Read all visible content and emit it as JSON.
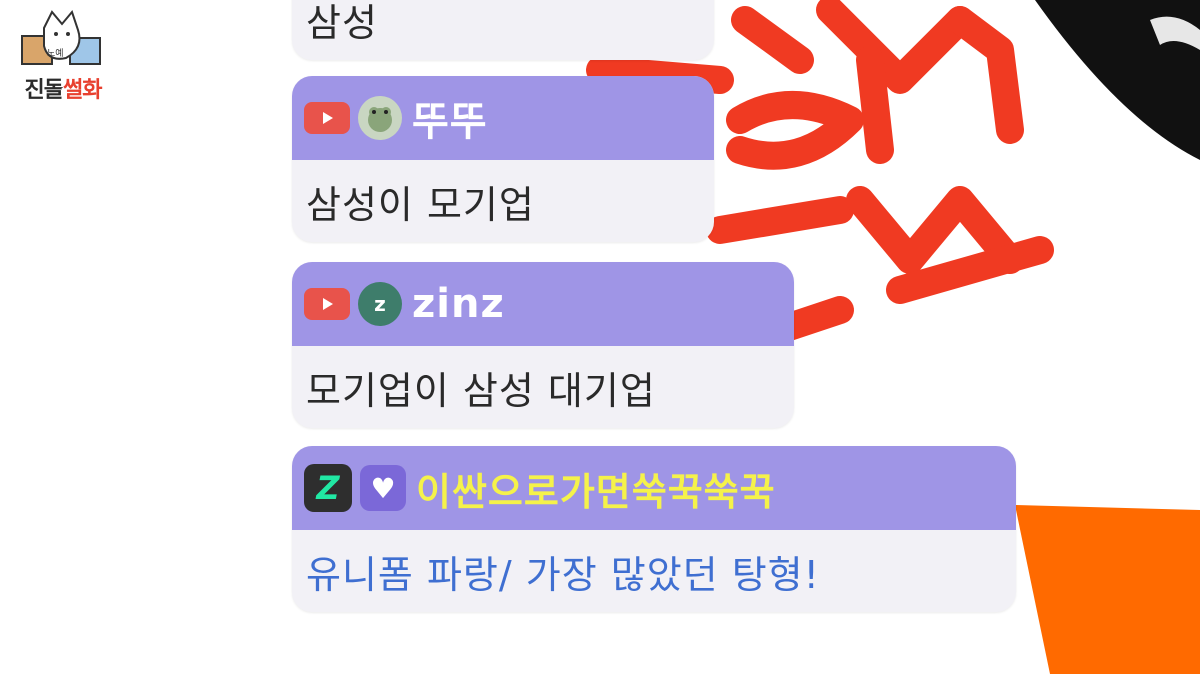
{
  "logo": {
    "text_main": "진돌",
    "text_accent": "썰화",
    "small_label": "노예"
  },
  "chat": {
    "messages": [
      {
        "platform_icon": "youtube-icon",
        "avatar_icon": "user-avatar",
        "name": "",
        "text": "삼성"
      },
      {
        "platform_icon": "youtube-icon",
        "avatar_icon": "frog-avatar",
        "name": "뚜뚜",
        "text": "삼성이 모기업"
      },
      {
        "platform_icon": "youtube-icon",
        "avatar_icon": "letter-avatar",
        "avatar_letter": "z",
        "name": "zinz",
        "text": "모기업이 삼성 대기업"
      },
      {
        "platform_icon": "chzzk-icon",
        "badge_icon": "heart-icon",
        "name": "이싼으로가면쑥꾹쑥꾹",
        "text": "유니폼 파랑/ 가장 많았던 탕형!"
      }
    ]
  },
  "colors": {
    "header_purple": "#9f95e6",
    "body_bg": "#f2f1f6",
    "highlight_name": "#f5f24a",
    "highlight_text": "#3f6fd1",
    "youtube_red": "#e8534b",
    "overlay_red": "#f03a22",
    "overlay_orange": "#ff6a00"
  }
}
